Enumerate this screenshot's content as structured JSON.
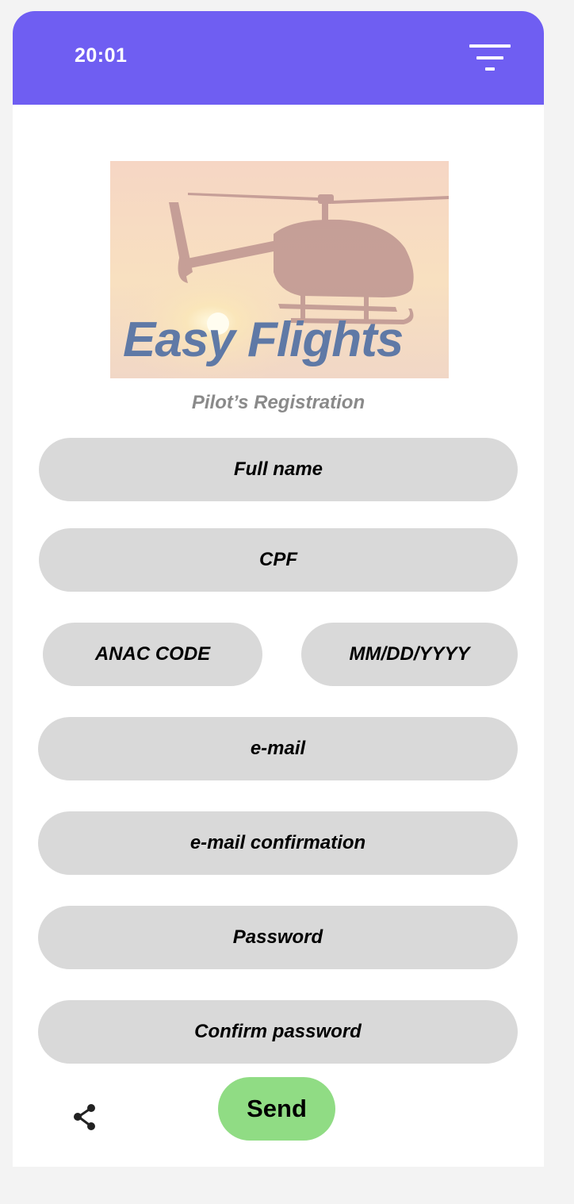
{
  "status_bar": {
    "time": "20:01",
    "menu_icon": "filter-lines-icon",
    "color": "#6f5ef2"
  },
  "hero": {
    "image": "helicopter-sunset-image",
    "title": "Easy Flights"
  },
  "subtitle": "Pilot’s Registration",
  "form": {
    "full_name": "Full name",
    "cpf": "CPF",
    "anac_code": "ANAC CODE",
    "birth_date": "MM/DD/YYYY",
    "email": "e-mail",
    "email_confirmation": "e-mail confirmation",
    "password": "Password",
    "confirm_password": "Confirm password",
    "field_color": "#d9d9d9"
  },
  "actions": {
    "send_label": "Send",
    "send_color": "#90dc84",
    "share_icon": "share-icon"
  }
}
